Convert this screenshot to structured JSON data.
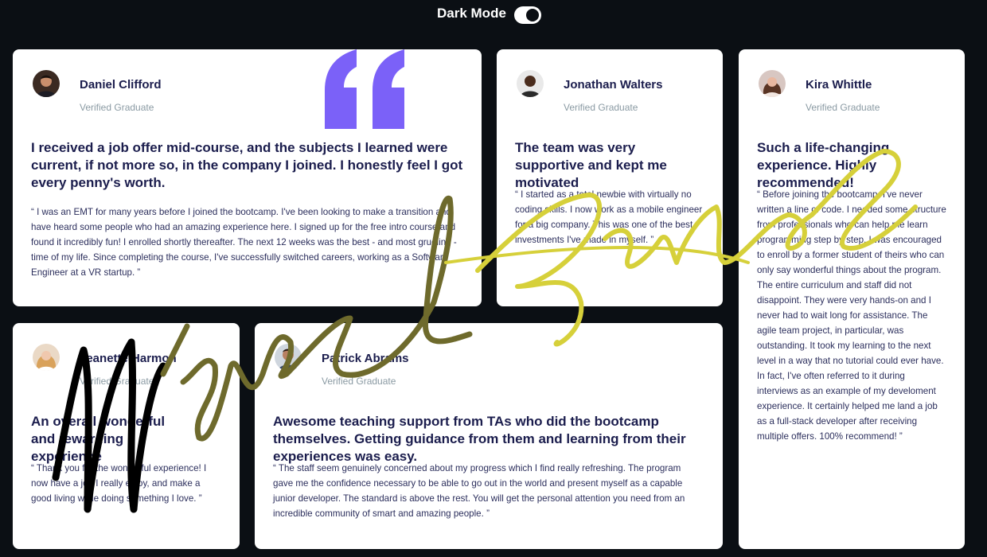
{
  "header": {
    "dark_mode_label": "Dark Mode",
    "dark_mode_enabled": true
  },
  "testimonials": [
    {
      "name": "Daniel Clifford",
      "role": "Verified Graduate",
      "headline": "I received a job offer mid-course, and the subjects I learned were current, if not more so, in the company I joined. I honestly feel I got every penny's worth.",
      "body": "“ I was an EMT for many years before I joined the bootcamp. I've been looking to make a transition and have heard some people who had an amazing experience here. I signed up for the free intro course and found it incredibly fun! I enrolled shortly thereafter. The next 12 weeks was the best - and most grueling - time of my life. Since completing the course, I've successfully switched careers, working as a Software Engineer at a VR startup. ”"
    },
    {
      "name": "Jonathan Walters",
      "role": "Verified Graduate",
      "headline": "The team was very supportive and kept me motivated",
      "body": "“ I started as a total newbie with virtually no coding skills. I now work as a mobile engineer for a big company. This was one of the best investments I've made in myself. ”"
    },
    {
      "name": "Kira Whittle",
      "role": "Verified Graduate",
      "headline": "Such a life-changing experience. Highly recommended!",
      "body": "“ Before joining the bootcamp, I've never written a line of code. I needed some structure from professionals who can help me learn programming step by step. I was encouraged to enroll by a former student of theirs who can only say wonderful things about the program. The entire curriculum and staff did not disappoint. They were very hands-on and I never had to wait long for assistance. The agile team project, in particular, was outstanding. It took my learning to the next level in a way that no tutorial could ever have. In fact, I've often referred to it during interviews as an example of my develoment experience. It certainly helped me land a job as a full-stack developer after receiving multiple offers. 100% recommend! ”"
    },
    {
      "name": "Jeanette Harmon",
      "role": "Verified Graduate",
      "headline": "An overall wonderful and rewarding experience",
      "body": "“ Thank you for the wonderful experience! I now have a job I really enjoy, and make a good living while doing something I love. ”"
    },
    {
      "name": "Patrick Abrams",
      "role": "Verified Graduate",
      "headline": "Awesome teaching support from TAs who did the bootcamp themselves. Getting guidance from them and learning from their experiences was easy.",
      "body": "“ The staff seem genuinely concerned about my progress which I find really refreshing. The program gave me the confidence necessary to be able to go out in the world and present myself as a capable junior developer. The standard is above the rest. You will get the personal attention you need from an incredible community of smart and amazing people. ”"
    }
  ],
  "decor": {
    "quote_icon": "quote-icon",
    "accent_color": "#7b61f8",
    "signature_text": "Miguel Ramos",
    "signature_colors": [
      "#000000",
      "#7a7a2e",
      "#d8d23a"
    ]
  }
}
